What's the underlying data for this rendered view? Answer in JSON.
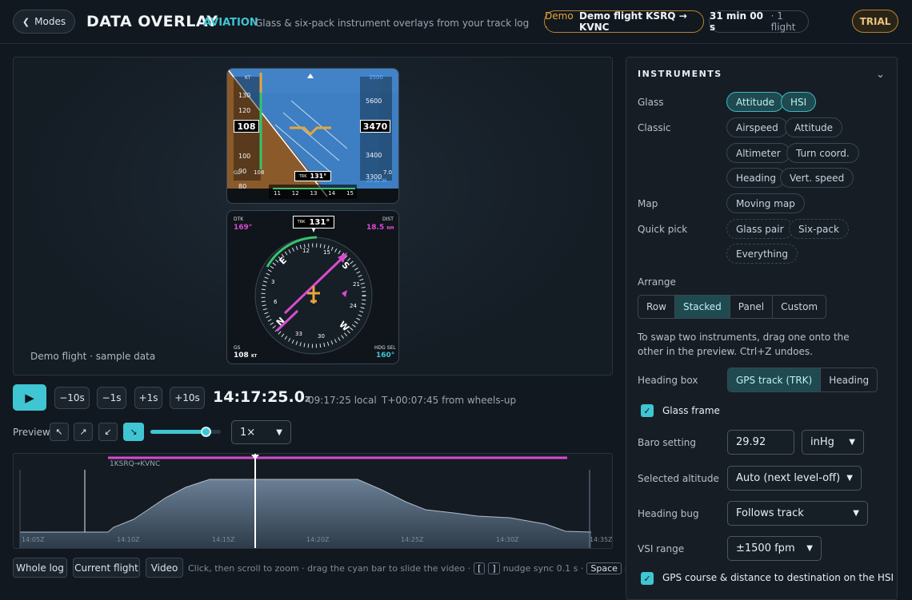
{
  "header": {
    "back_label": "Modes",
    "title": "DATA OVERLAY",
    "mode": "AVIATION",
    "subtitle": "Glass & six-pack instrument overlays from your track log",
    "demo_prefix": "Demo ·",
    "demo_flight": "Demo flight KSRQ → KVNC",
    "duration": "31 min 00 s",
    "flights": "· 1 flight",
    "trial": "TRIAL"
  },
  "preview": {
    "caption": "Demo flight · sample data"
  },
  "pfd": {
    "spd_unit": "KT",
    "speeds": [
      "130",
      "120",
      "110",
      "108",
      "100",
      "90",
      "80"
    ],
    "speed_current": "108",
    "gs_label": "GL",
    "gs_value": "108",
    "alt_sel": "3500",
    "alts": [
      "5600",
      "4600",
      "3470",
      "3400",
      "3300"
    ],
    "alt_current": "3470",
    "vs": "7.0",
    "baro": "29.92 IN",
    "trk_label": "TRK",
    "trk_value": "131°",
    "hdg_ticks": [
      "11",
      "12",
      "13",
      "14",
      "15"
    ],
    "roll": [
      "10",
      "20",
      "30"
    ]
  },
  "hsi": {
    "trk_label": "TRK",
    "trk_value": "131°",
    "dtk_label": "DTK",
    "dtk_value": "169°",
    "dist_label": "DIST",
    "dist_value": "18.5",
    "dist_unit": "NM",
    "gs_label": "GS",
    "gs_value": "108",
    "gs_unit": "KT",
    "hdg_sel_label": "HDG SEL",
    "hdg_sel_value": "160°",
    "cardinals": [
      "N",
      "E",
      "S",
      "W"
    ],
    "nums": [
      "3",
      "6",
      "12",
      "15",
      "21",
      "24",
      "30",
      "33"
    ]
  },
  "transport": {
    "play": "▶",
    "back10": "−10s",
    "back1": "−1s",
    "fwd1": "+1s",
    "fwd10": "+10s",
    "time": "14:17:25.0",
    "time_suffix": "z",
    "local": "09:17:25 local",
    "elapsed": "T+00:07:45 from wheels-up",
    "preview_label": "Preview",
    "speed": "1×",
    "slider_value": 0.78
  },
  "timeline": {
    "route": "1KSRQ→KVNC",
    "ticks": [
      "14:05Z",
      "14:10Z",
      "14:15Z",
      "14:20Z",
      "14:25Z",
      "14:30Z",
      "14:35Z"
    ],
    "buttons": [
      "Whole log",
      "Current flight",
      "Video"
    ],
    "help": "Click, then scroll to zoom · drag the cyan bar to slide the video ·",
    "key1": "[",
    "key2": "]",
    "help2": "nudge sync 0.1 s ·",
    "key3": "Space",
    "help3": "play"
  },
  "panel": {
    "title": "INSTRUMENTS",
    "glass_label": "Glass",
    "glass": [
      "Attitude",
      "HSI"
    ],
    "classic_label": "Classic",
    "classic": [
      "Airspeed",
      "Attitude",
      "Altimeter",
      "Turn coord.",
      "Heading",
      "Vert. speed"
    ],
    "map_label": "Map",
    "map": [
      "Moving map"
    ],
    "quick_label": "Quick pick",
    "quick": [
      "Glass pair",
      "Six-pack",
      "Everything"
    ],
    "arrange_label": "Arrange",
    "arrange": [
      "Row",
      "Stacked",
      "Panel",
      "Custom"
    ],
    "arrange_help": "To swap two instruments, drag one onto the other in the preview. Ctrl+Z undoes.",
    "hbox_label": "Heading box",
    "hbox": [
      "GPS track (TRK)",
      "Heading"
    ],
    "glass_frame": "Glass frame",
    "baro_label": "Baro setting",
    "baro_value": "29.92",
    "baro_unit": "inHg",
    "selalt_label": "Selected altitude",
    "selalt_value": "Auto (next level-off)",
    "hbug_label": "Heading bug",
    "hbug_value": "Follows track",
    "vsi_label": "VSI range",
    "vsi_value": "±1500 fpm",
    "gps_opt": "GPS course & distance to destination on the HSI"
  },
  "colors": {
    "accent": "#3fc6d2",
    "magenta": "#d94bd0",
    "amber": "#e8a53a",
    "green": "#37c46b"
  }
}
